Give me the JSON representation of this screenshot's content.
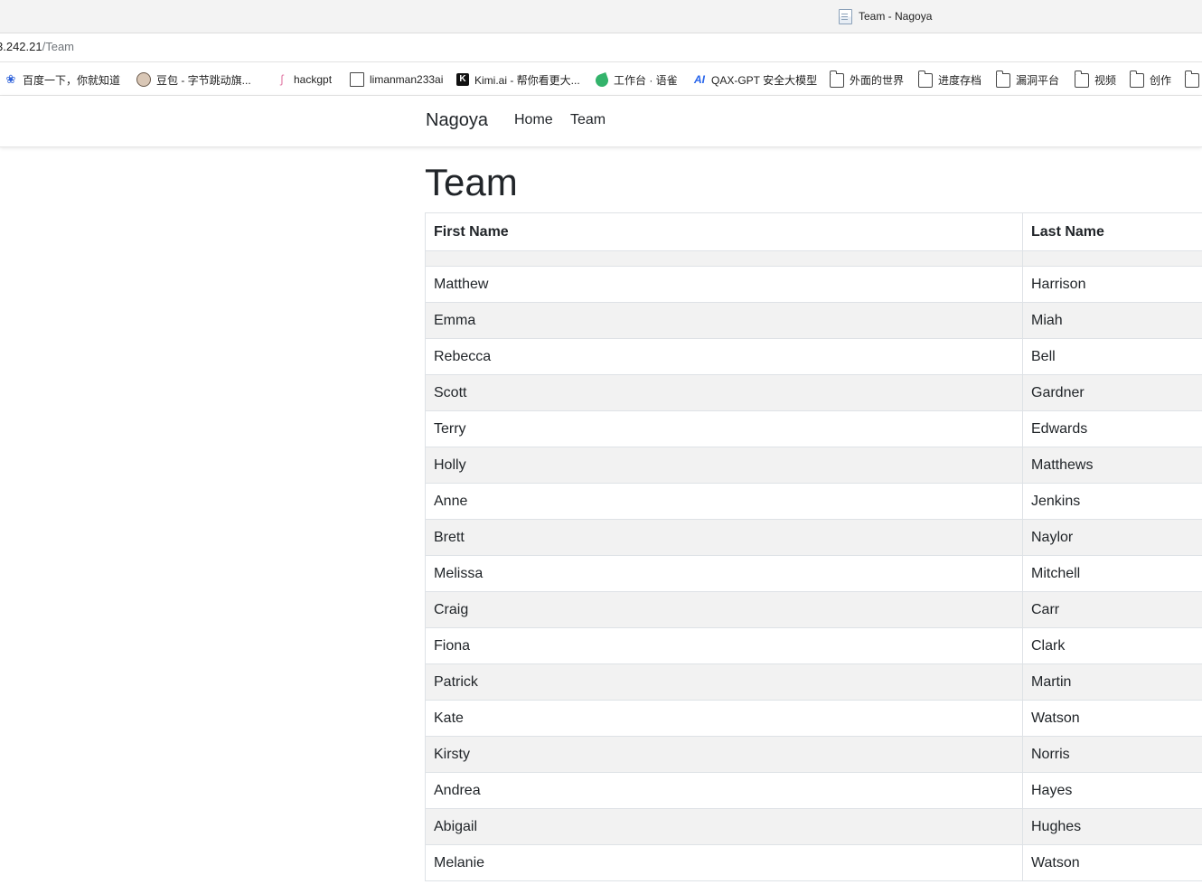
{
  "browser": {
    "tab_title": "Team - Nagoya",
    "url_host": "3.242.21",
    "url_path": "/Team",
    "bookmarks": [
      {
        "label": "百度一下，你就知道",
        "icon": "baidu-paw-icon"
      },
      {
        "label": "豆包 - 字节跳动旗...",
        "icon": "doubao-avatar-icon"
      },
      {
        "label": "hackgpt",
        "icon": "hackgpt-icon"
      },
      {
        "label": "limanman233ai",
        "icon": "document-icon"
      },
      {
        "label": "Kimi.ai - 帮你看更大...",
        "icon": "kimi-icon"
      },
      {
        "label": "工作台 · 语雀",
        "icon": "yuque-icon"
      },
      {
        "label": "QAX-GPT 安全大模型",
        "icon": "qax-ai-icon"
      },
      {
        "label": "外面的世界",
        "icon": "folder-icon"
      },
      {
        "label": "进度存档",
        "icon": "folder-icon"
      },
      {
        "label": "漏洞平台",
        "icon": "folder-icon"
      },
      {
        "label": "视频",
        "icon": "folder-icon"
      },
      {
        "label": "创作",
        "icon": "folder-icon"
      }
    ]
  },
  "navbar": {
    "brand": "Nagoya",
    "links": [
      "Home",
      "Team"
    ]
  },
  "page": {
    "title": "Team",
    "columns": [
      "First Name",
      "Last Name"
    ],
    "rows": [
      [
        "",
        ""
      ],
      [
        "Matthew",
        "Harrison"
      ],
      [
        "Emma",
        "Miah"
      ],
      [
        "Rebecca",
        "Bell"
      ],
      [
        "Scott",
        "Gardner"
      ],
      [
        "Terry",
        "Edwards"
      ],
      [
        "Holly",
        "Matthews"
      ],
      [
        "Anne",
        "Jenkins"
      ],
      [
        "Brett",
        "Naylor"
      ],
      [
        "Melissa",
        "Mitchell"
      ],
      [
        "Craig",
        "Carr"
      ],
      [
        "Fiona",
        "Clark"
      ],
      [
        "Patrick",
        "Martin"
      ],
      [
        "Kate",
        "Watson"
      ],
      [
        "Kirsty",
        "Norris"
      ],
      [
        "Andrea",
        "Hayes"
      ],
      [
        "Abigail",
        "Hughes"
      ],
      [
        "Melanie",
        "Watson"
      ]
    ]
  }
}
